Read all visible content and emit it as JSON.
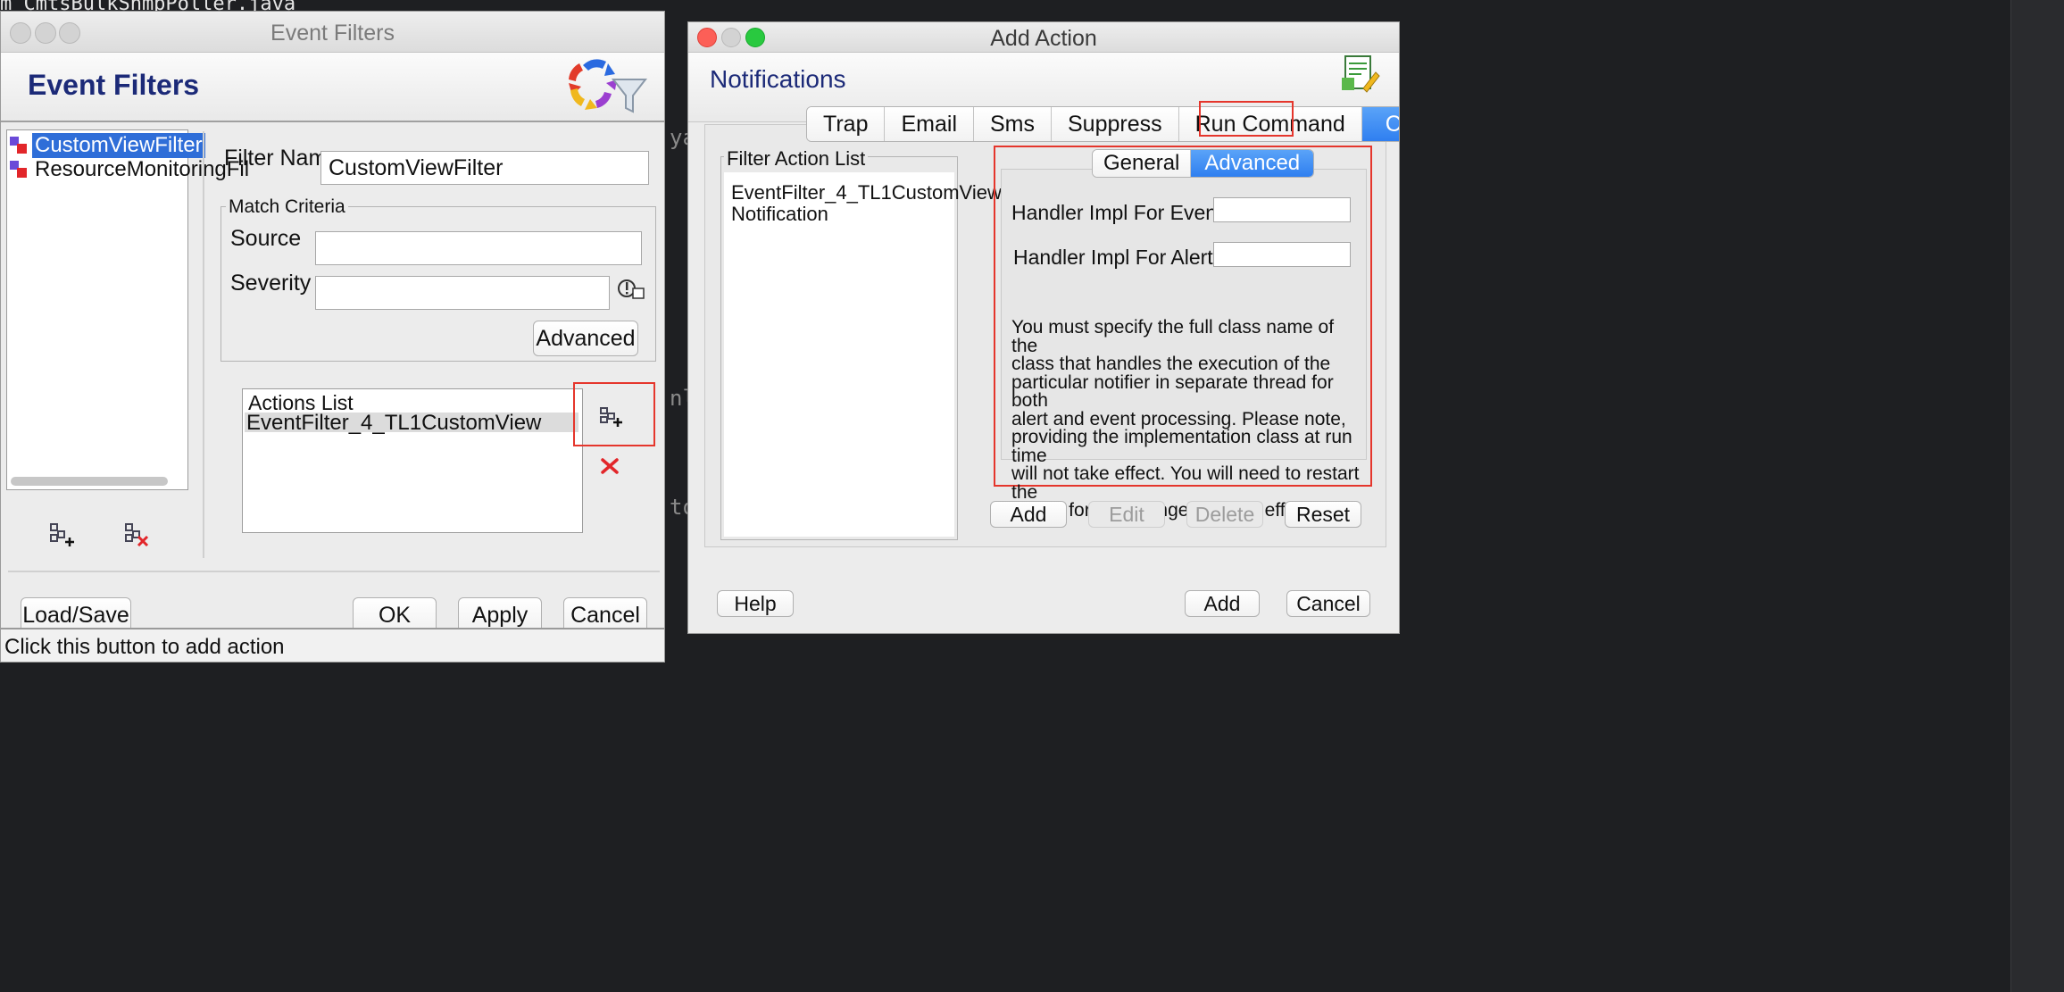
{
  "background": {
    "terminal_text": "m CmtsBulkSnmpPoller.java",
    "behind_fragments": [
      "yat",
      "nl#",
      "to"
    ]
  },
  "event_filters_window": {
    "window_title": "Event Filters",
    "header_title": "Event Filters",
    "filter_tree": [
      "CustomViewFilter",
      "ResourceMonitoringFil"
    ],
    "filter_name_label": "Filter Name",
    "filter_name_value": "CustomViewFilter",
    "match_criteria_label": "Match Criteria",
    "source_label": "Source",
    "source_value": "",
    "severity_label": "Severity",
    "severity_value": "",
    "advanced_button": "Advanced",
    "actions_list_header": "Actions List",
    "actions": [
      "EventFilter_4_TL1CustomView"
    ],
    "load_save_button": "Load/Save",
    "ok_button": "OK",
    "apply_button": "Apply",
    "cancel_button": "Cancel",
    "status_text": "Click this button to add action"
  },
  "add_action_window": {
    "window_title": "Add Action",
    "header_title": "Notifications",
    "tabs": [
      "Trap",
      "Email",
      "Sms",
      "Suppress",
      "Run Command",
      "Custom"
    ],
    "selected_tab": "Custom",
    "filter_action_list_label": "Filter Action List",
    "filter_action_items": [
      "EventFilter_4_TL1CustomView",
      "Notification"
    ],
    "sub_tabs": [
      "General",
      "Advanced"
    ],
    "selected_sub_tab": "Advanced",
    "handler_events_label": "Handler Impl For Events",
    "handler_events_value": "",
    "handler_alerts_label": "Handler Impl For Alerts",
    "handler_alerts_value": "",
    "info_lines": [
      "You must specify the full class name of the",
      "class that handles the execution of the",
      "particular notifier in separate thread for both",
      "alert and event processing. Please note,",
      "providing the implementation class at run time",
      "will not take effect. You will need to restart the",
      "server for the changes to take effect."
    ],
    "add_button": "Add",
    "edit_button": "Edit",
    "delete_button": "Delete",
    "reset_button": "Reset",
    "help_button": "Help",
    "footer_add_button": "Add",
    "footer_cancel_button": "Cancel"
  },
  "colors": {
    "highlight": "#e5362c",
    "selection": "#2f7ff0",
    "header_title": "#1c2a78"
  },
  "icons": [
    "event-filters-logo-icon",
    "notifications-logo-icon",
    "add-action-icon",
    "delete-action-icon",
    "add-filter-icon",
    "delete-filter-icon",
    "severity-picker-icon",
    "filter-node-icon"
  ]
}
